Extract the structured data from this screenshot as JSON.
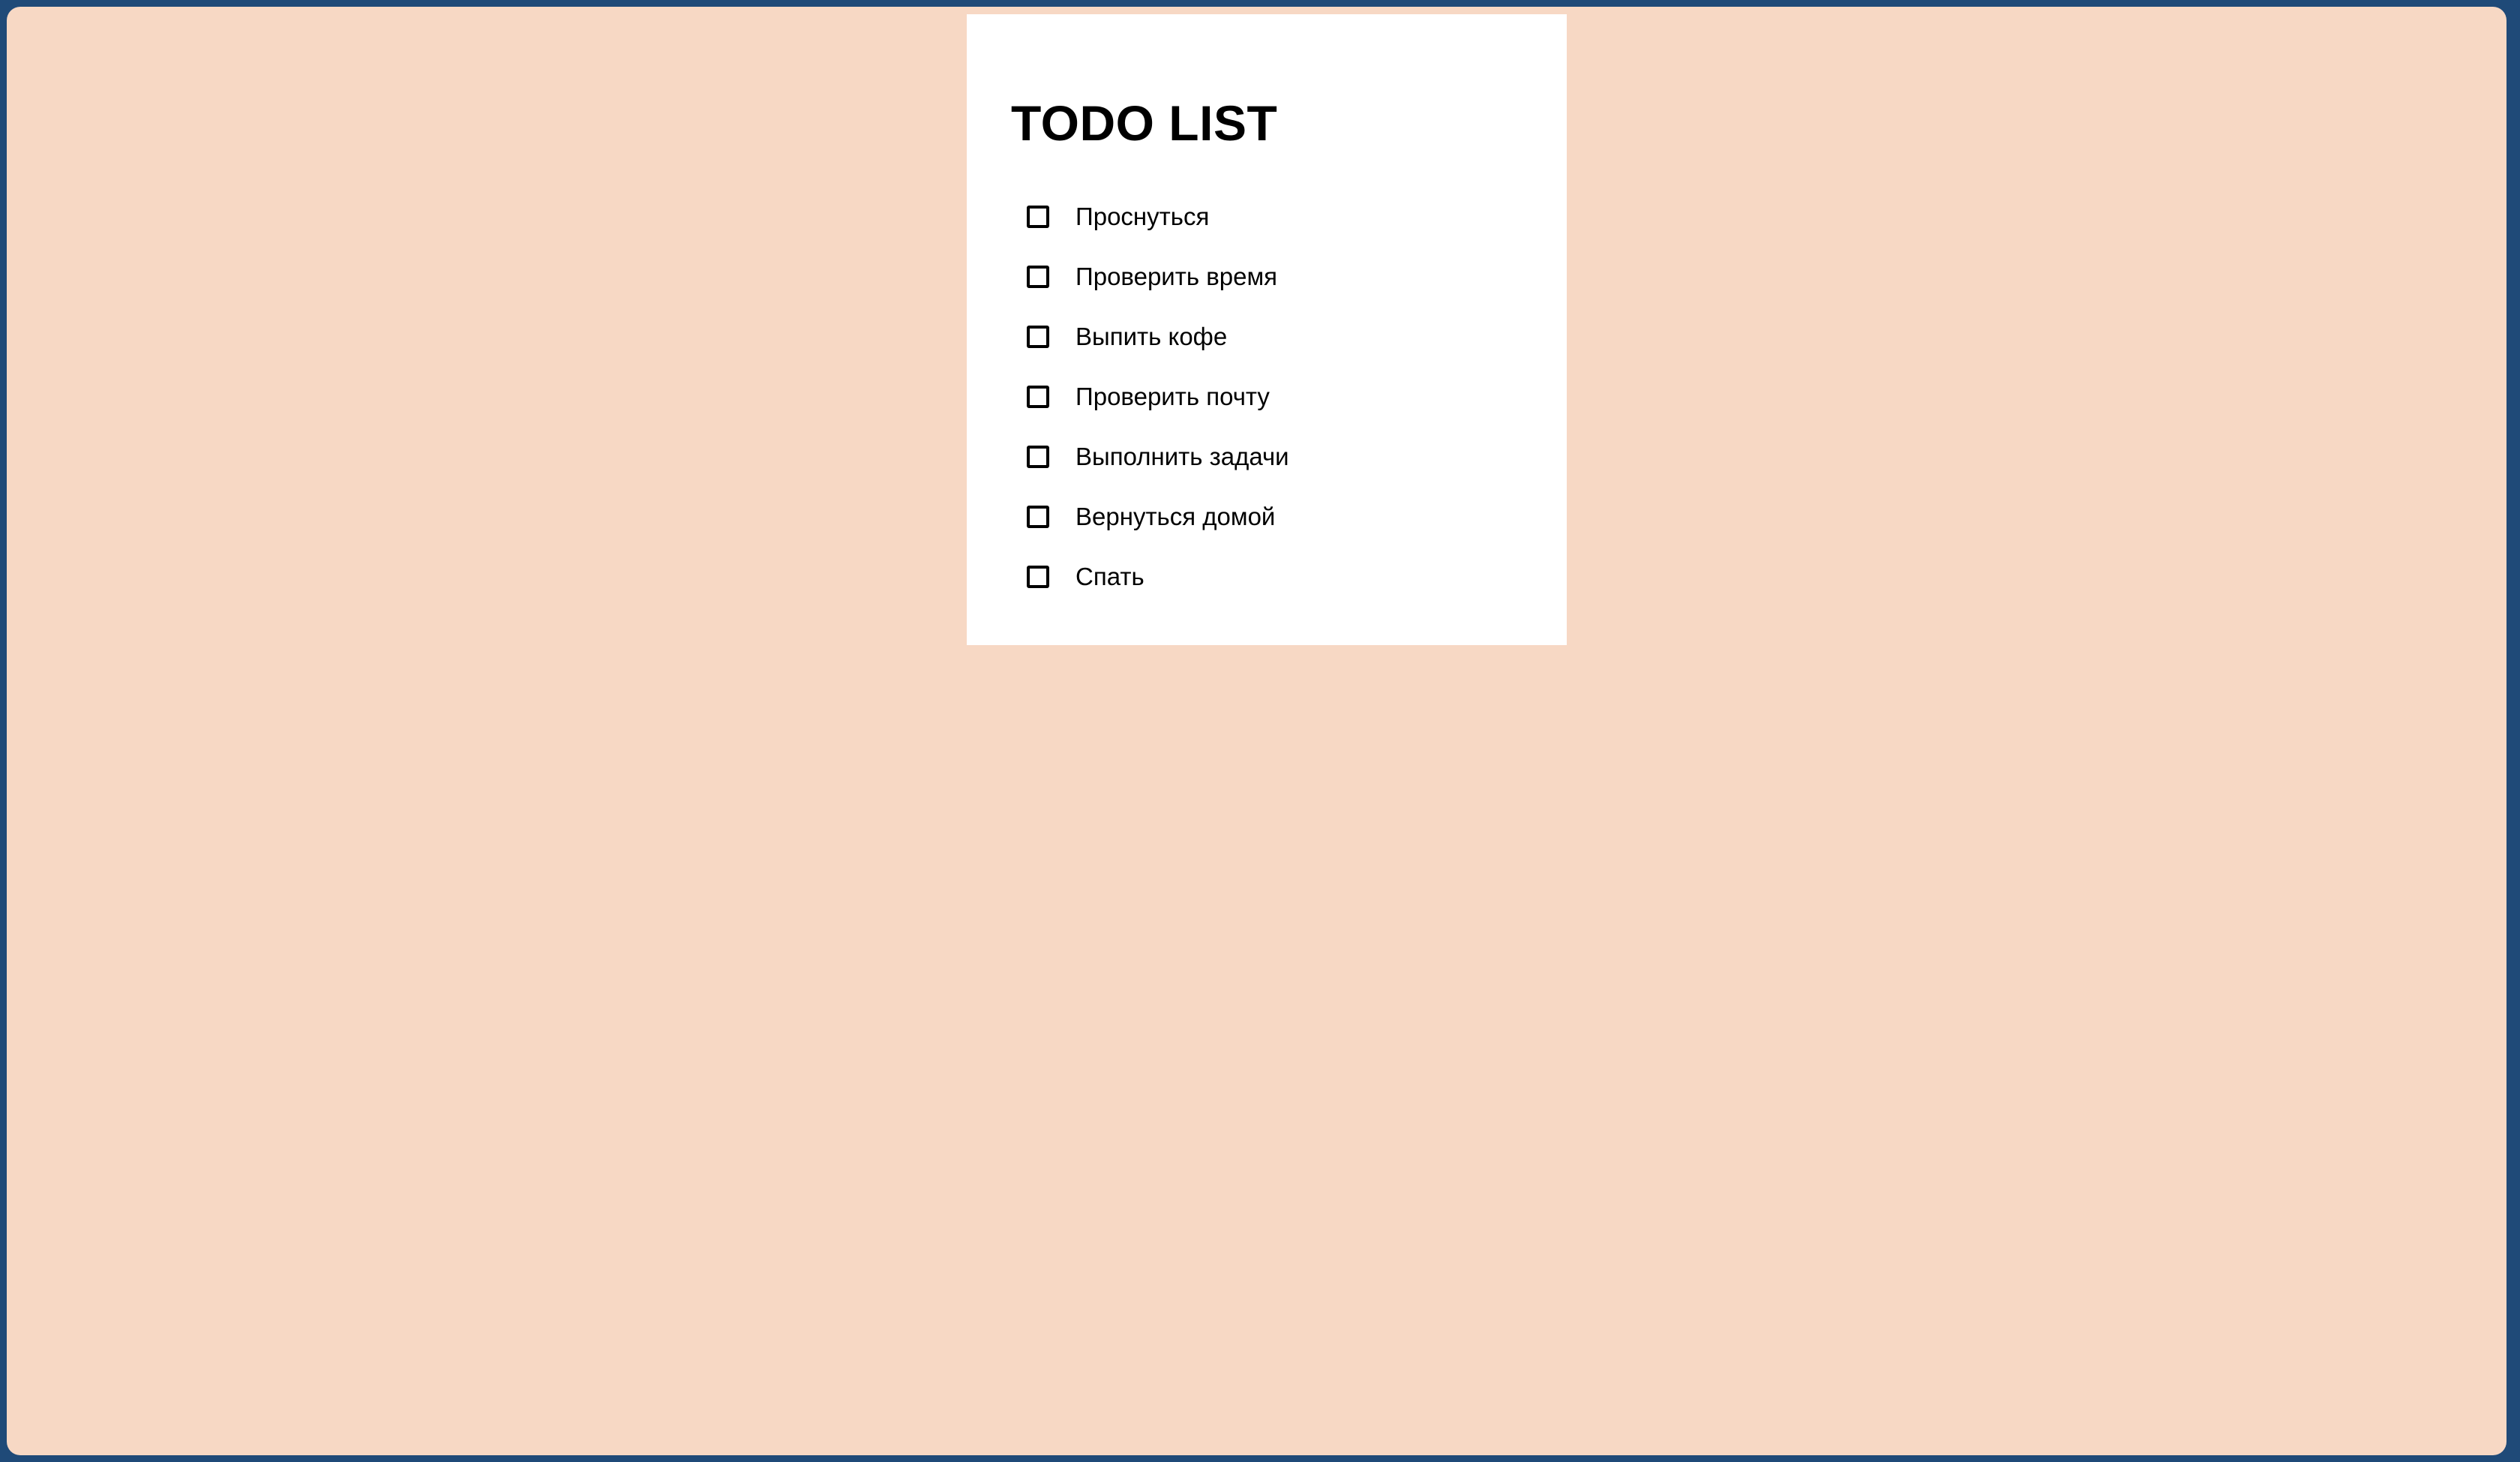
{
  "colors": {
    "outer_border": "#1f4a78",
    "page_background": "#f7d8c4",
    "card_background": "#ffffff",
    "text": "#000000"
  },
  "todo": {
    "title": "TODO LIST",
    "items": [
      {
        "label": "Проснуться",
        "checked": false
      },
      {
        "label": "Проверить время",
        "checked": false
      },
      {
        "label": "Выпить кофе",
        "checked": false
      },
      {
        "label": "Проверить почту",
        "checked": false
      },
      {
        "label": "Выполнить задачи",
        "checked": false
      },
      {
        "label": "Вернуться домой",
        "checked": false
      },
      {
        "label": "Спать",
        "checked": false
      }
    ]
  }
}
